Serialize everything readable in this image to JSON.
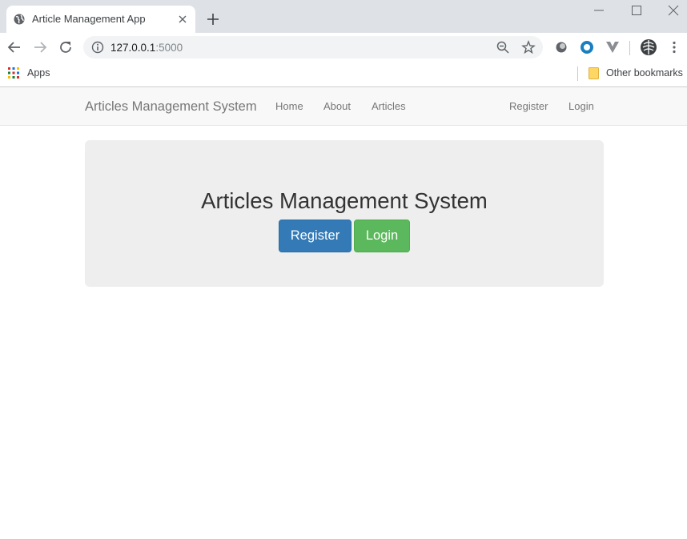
{
  "browser": {
    "tab_title": "Article Management App",
    "url_host": "127.0.0.1",
    "url_port": ":5000",
    "bookmarks": {
      "apps_label": "Apps",
      "other_label": "Other bookmarks"
    }
  },
  "navbar": {
    "brand": "Articles Management System",
    "links": [
      {
        "label": "Home"
      },
      {
        "label": "About"
      },
      {
        "label": "Articles"
      }
    ],
    "right_links": [
      {
        "label": "Register"
      },
      {
        "label": "Login"
      }
    ]
  },
  "jumbotron": {
    "title": "Articles Management System",
    "register_label": "Register",
    "login_label": "Login"
  },
  "colors": {
    "primary": "#337ab7",
    "success": "#5cb85c",
    "jumbotron_bg": "#eeeeee",
    "navbar_bg": "#f8f8f8"
  }
}
